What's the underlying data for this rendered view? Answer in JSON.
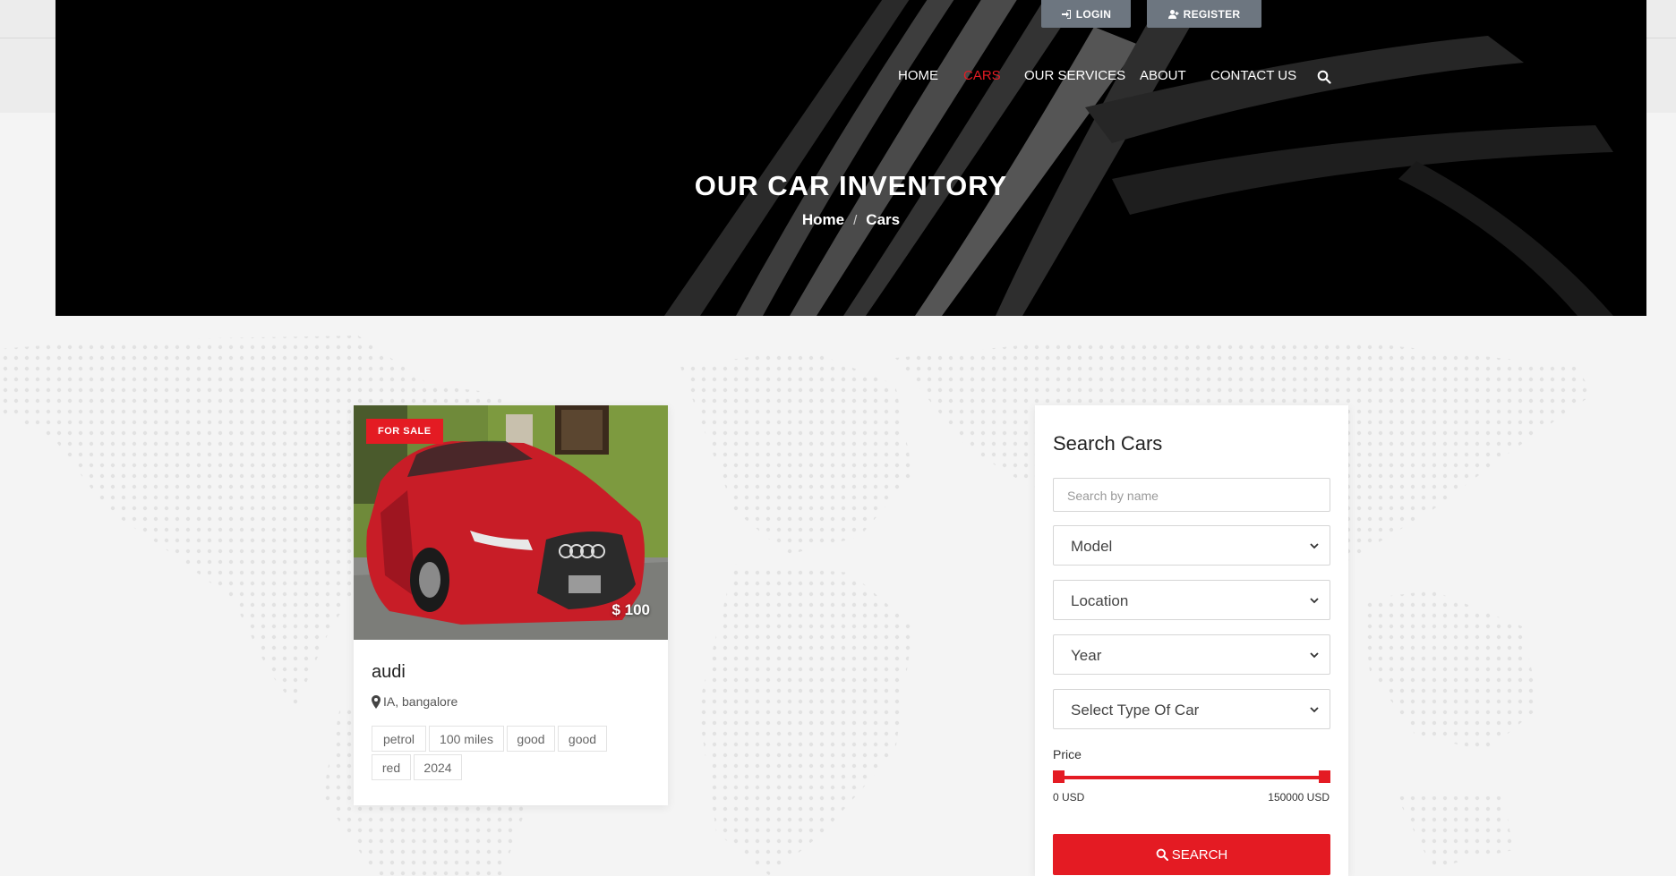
{
  "header": {
    "login_label": "LOGIN",
    "register_label": "REGISTER",
    "nav": [
      {
        "label": "HOME",
        "active": false
      },
      {
        "label": "CARS",
        "active": true
      },
      {
        "label": "OUR SERVICES",
        "active": false
      },
      {
        "label": "ABOUT",
        "active": false
      },
      {
        "label": "CONTACT US",
        "active": false
      }
    ]
  },
  "hero": {
    "title": "OUR CAR INVENTORY",
    "breadcrumb": [
      "Home",
      "Cars"
    ],
    "separator": "/"
  },
  "car": {
    "status": "FOR SALE",
    "price": "$ 100",
    "name": "audi",
    "location": "IA, bangalore",
    "tags": [
      "petrol",
      "100 miles",
      "good",
      "good",
      "red",
      "2024"
    ]
  },
  "sidebar": {
    "title": "Search Cars",
    "search_placeholder": "Search by name",
    "selects": [
      "Model",
      "Location",
      "Year",
      "Select Type Of Car"
    ],
    "price_label": "Price",
    "price_min": "0 USD",
    "price_max": "150000 USD",
    "search_label": "SEARCH"
  },
  "colors": {
    "accent": "#e41b23",
    "hero_bg": "#000000",
    "auth_button": "#6d7680"
  }
}
